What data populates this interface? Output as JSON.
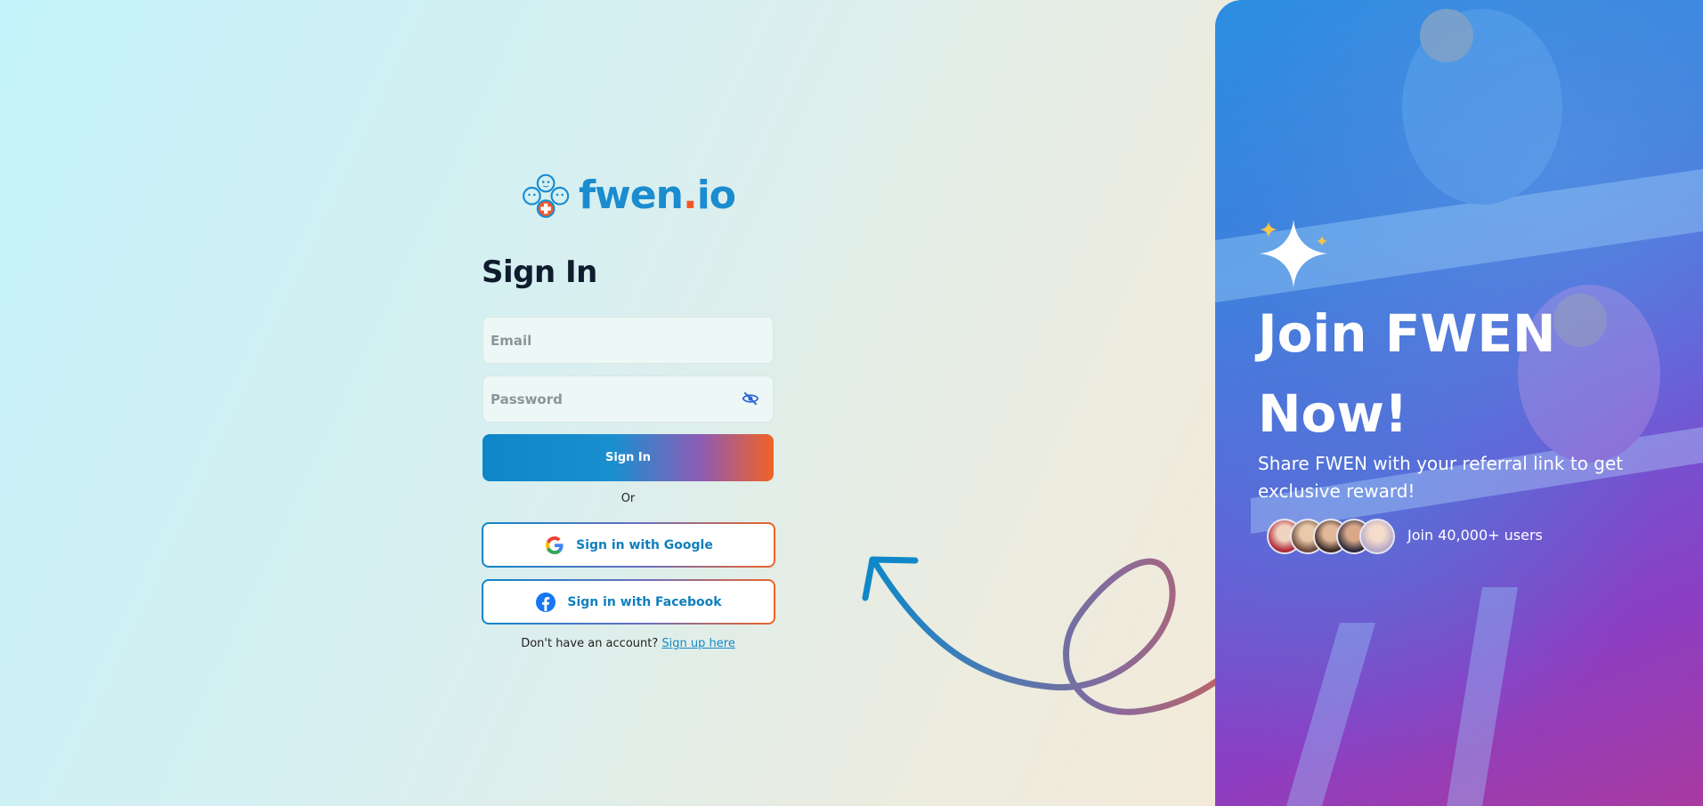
{
  "logo": {
    "text_main": "fwen",
    "text_dot": ".",
    "text_suffix": "io"
  },
  "form": {
    "title": "Sign In",
    "email_placeholder": "Email",
    "password_placeholder": "Password",
    "sign_in_label": "Sign In",
    "or_label": "Or",
    "google_label": "Sign in with Google",
    "facebook_label": "Sign in with Facebook",
    "no_account_text": "Don't have an account?",
    "sign_up_link": "Sign up here"
  },
  "panel": {
    "title": "Join FWEN Now!",
    "subtitle": "Share FWEN with your referral link to get exclusive reward!",
    "users_text": "Join 40,000+ users",
    "avatar_count": 5
  },
  "colors": {
    "brand_blue": "#1a8ccf",
    "brand_orange": "#f0592a",
    "panel_purple": "#8b3fc4"
  },
  "icons": [
    "logo-icon",
    "eye-slash-icon",
    "google-icon",
    "facebook-icon",
    "curly-arrow-icon",
    "sparkle-icon"
  ]
}
